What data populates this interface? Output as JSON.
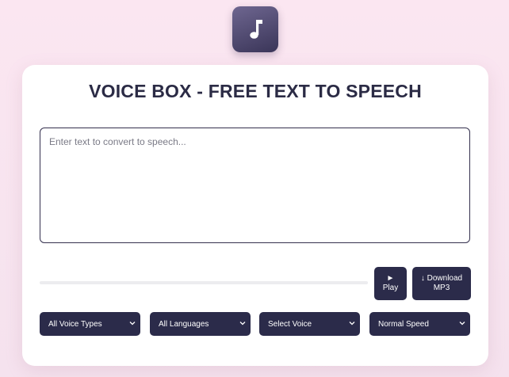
{
  "logo": {
    "icon": "music-note-icon"
  },
  "header": {
    "title": "VOICE BOX - FREE TEXT TO SPEECH"
  },
  "editor": {
    "placeholder": "Enter text to convert to speech...",
    "value": ""
  },
  "playback": {
    "progress": 0
  },
  "buttons": {
    "play_icon": "►",
    "play_label": "Play",
    "download_line1": "↓ Download",
    "download_line2": "MP3"
  },
  "filters": {
    "voice_type": "All Voice Types",
    "language": "All Languages",
    "voice": "Select Voice",
    "speed": "Normal Speed"
  },
  "colors": {
    "accent": "#2b2b4a",
    "background": "#fbe6f1",
    "title": "#2b2b45"
  }
}
